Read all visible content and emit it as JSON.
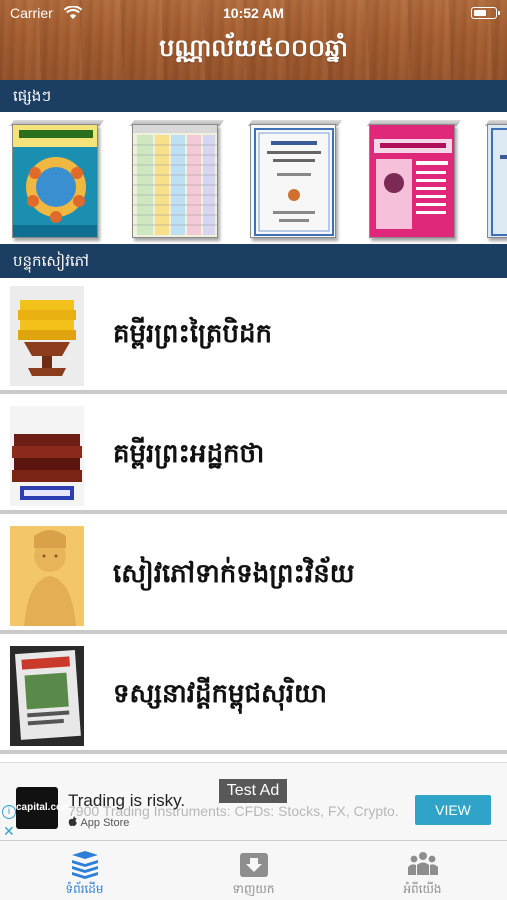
{
  "status_bar": {
    "carrier": "Carrier",
    "time": "10:52 AM",
    "battery_level": 0.6
  },
  "header": {
    "title": "បណ្ណាល័យ៥០០០ឆ្នាំ"
  },
  "sections": {
    "featured_label": "ផ្សេងៗ",
    "books_label": "បន្ទុកសៀវភៅ"
  },
  "featured_books": [
    {
      "name": "book-cover-1",
      "color": "#1a8fb0"
    },
    {
      "name": "book-cover-2",
      "color": "#e6e6c8"
    },
    {
      "name": "book-cover-3",
      "color": "#f4f4f4"
    },
    {
      "name": "book-cover-4",
      "color": "#e0287a"
    },
    {
      "name": "book-cover-5",
      "color": "#dce8f2"
    }
  ],
  "book_list": [
    {
      "label": "គម្ពីរព្រះត្រៃបិដក"
    },
    {
      "label": "គម្ពីរព្រះអដ្ឋកថា"
    },
    {
      "label": "សៀវភៅទាក់ទងព្រះវិន័យ"
    },
    {
      "label": "ទស្សនាវដ្ដីកម្ពុជសុរិយា"
    }
  ],
  "ad": {
    "tag": "Test Ad",
    "logo_text": "capital.com",
    "headline": "Trading is risky.",
    "body": "7900 Trading Instruments: CFDs: Stocks, FX, Crypto.",
    "store": "App Store",
    "cta": "VIEW",
    "info_symbol": "i",
    "close_symbol": "✕"
  },
  "tabs": [
    {
      "label": "ទំព័រដើម",
      "active": true
    },
    {
      "label": "ទាញយក",
      "active": false
    },
    {
      "label": "អំពីយើង",
      "active": false
    }
  ],
  "colors": {
    "section_bar": "#1d3e63",
    "tab_active": "#2c7fd8",
    "ad_cta": "#2fa4c8"
  }
}
